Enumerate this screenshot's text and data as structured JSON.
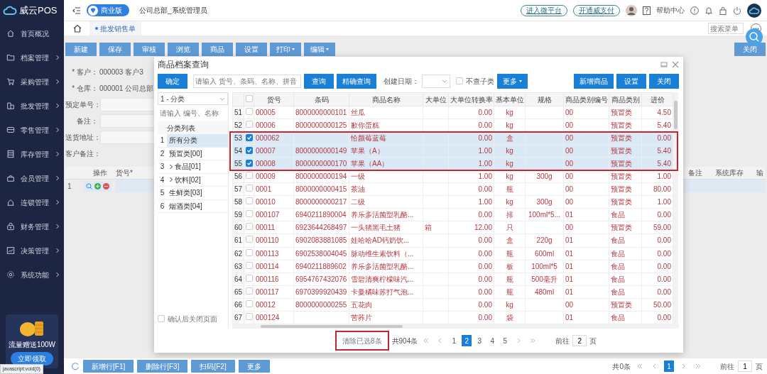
{
  "sidebar": {
    "logo": "威云POS",
    "items": [
      {
        "label": "首页概况",
        "expandable": false
      },
      {
        "label": "档案管理",
        "expandable": true
      },
      {
        "label": "采购管理",
        "expandable": true
      },
      {
        "label": "批发管理",
        "expandable": true
      },
      {
        "label": "零售管理",
        "expandable": true
      },
      {
        "label": "库存管理",
        "expandable": true
      },
      {
        "label": "会员管理",
        "expandable": true
      },
      {
        "label": "连锁管理",
        "expandable": true
      },
      {
        "label": "财务管理",
        "expandable": true
      },
      {
        "label": "决策管理",
        "expandable": true
      },
      {
        "label": "系统功能",
        "expandable": true
      }
    ],
    "promo": {
      "text": "流量赠送100W",
      "button": "立即领取"
    }
  },
  "status_text": "javascript:void(0)",
  "topbar": {
    "edition": "商业版",
    "user": "公司总部_系统管理员",
    "links": [
      "进入微平台",
      "开通威支付"
    ],
    "help": "帮助中心"
  },
  "tabs": [
    {
      "label": "批发销售单",
      "selected": true
    }
  ],
  "menu_search": {
    "placeholder": "搜索菜单"
  },
  "toolbar": [
    {
      "label": "新建",
      "dropdown": false
    },
    {
      "label": "保存",
      "dropdown": false
    },
    {
      "label": "审核",
      "dropdown": false
    },
    {
      "label": "浏览",
      "dropdown": false
    },
    {
      "label": "商品",
      "dropdown": false
    },
    {
      "label": "设置",
      "dropdown": false
    },
    {
      "label": "打印",
      "dropdown": true
    },
    {
      "label": "编辑",
      "dropdown": true
    }
  ],
  "close_button": "关闭",
  "form": [
    {
      "label": "* 客户：",
      "value": "000003  客户3",
      "field": false
    },
    {
      "label": "* 仓库：",
      "value": "000001 公司总部",
      "field": false
    },
    {
      "label": "预定单号：",
      "field": true
    },
    {
      "label": "备注：",
      "field": true
    },
    {
      "label": "送货地址：",
      "field": true
    },
    {
      "label": "客户备注：",
      "field": false
    }
  ],
  "grid": {
    "columns_left": [
      "操作",
      "货号*"
    ],
    "columns_right": [
      "备注",
      "系统库存",
      "输"
    ],
    "rows": [
      {
        "number": "1"
      }
    ]
  },
  "bottom_buttons": [
    "新增行[F1]",
    "删除行[F3]",
    "扫码[F2]",
    "更多"
  ],
  "bottom_pager": {
    "total": "共0条",
    "pages": [
      {
        "label": "1",
        "selected": true
      }
    ],
    "goto_label": "前往",
    "goto_value": "1",
    "page_unit": "页"
  },
  "dialog": {
    "title": "商品档案查询",
    "confirm": "确定",
    "search": {
      "placeholder": "请输入 货号、条码、名称、拼音"
    },
    "query_buttons": [
      "查询",
      "精确查询"
    ],
    "date_label": "创建日期：",
    "exclude_sub": {
      "label": "不查子类",
      "checked": false
    },
    "more": "更多",
    "right_buttons": [
      "新增商品",
      "设置",
      "关闭"
    ],
    "category_select": "1 - 分类",
    "category_search": {
      "placeholder": "请输入 编号、名称"
    },
    "category_header": "分类列表",
    "categories": [
      {
        "number": "1",
        "label": "所有分类",
        "selected": true,
        "expandable": false
      },
      {
        "number": "2",
        "label": "预置类[00]",
        "selected": false,
        "expandable": false
      },
      {
        "number": "3",
        "label": "食品[01]",
        "selected": false,
        "expandable": true
      },
      {
        "number": "4",
        "label": "饮料[02]",
        "selected": false,
        "expandable": true
      },
      {
        "number": "5",
        "label": "生鲜类[03]",
        "selected": false,
        "expandable": false
      },
      {
        "number": "6",
        "label": "烟酒类[04]",
        "selected": false,
        "expandable": false
      }
    ],
    "close_after_confirm": {
      "label": "确认后关闭页面",
      "checked": false
    },
    "table": {
      "select_all": false,
      "columns": [
        "货号",
        "条码",
        "商品名称",
        "大单位",
        "大单位转换率",
        "基本单位",
        "规格",
        "商品类别编号",
        "商品类别",
        "进价"
      ],
      "rows": [
        {
          "number": "51",
          "checked": false,
          "emphasized": false,
          "cells": [
            "00005",
            "8000000000101",
            "丝瓜",
            "",
            "0.00",
            "kg",
            "",
            "00",
            "预置类",
            "4.50"
          ]
        },
        {
          "number": "52",
          "checked": false,
          "emphasized": false,
          "cells": [
            "00006",
            "8000000000125",
            "歉你蛋糕",
            "",
            "0.00",
            "kg",
            "",
            "00",
            "预置类",
            "5.40"
          ]
        },
        {
          "number": "53",
          "checked": true,
          "emphasized": true,
          "cells": [
            "000062",
            "",
            "恰颜莓蓝莓",
            "",
            "0.00",
            "盒",
            "",
            "00",
            "预置类",
            "0.00"
          ]
        },
        {
          "number": "54",
          "checked": true,
          "emphasized": true,
          "cells": [
            "00007",
            "8000000000149",
            "苹果（A）",
            "",
            "1.00",
            "kg",
            "",
            "00",
            "预置类",
            "5.40"
          ]
        },
        {
          "number": "55",
          "checked": true,
          "emphasized": true,
          "cells": [
            "00008",
            "8000000000170",
            "苹果（AA）",
            "",
            "1.00",
            "kg",
            "",
            "00",
            "预置类",
            "5.40"
          ]
        },
        {
          "number": "56",
          "checked": false,
          "emphasized": false,
          "cells": [
            "00009",
            "8000000000194",
            "一级",
            "",
            "1.00",
            "kg",
            "300g",
            "00",
            "预置类",
            "1.00"
          ]
        },
        {
          "number": "57",
          "checked": false,
          "emphasized": false,
          "cells": [
            "0001",
            "8000000000415",
            "茶油",
            "",
            "0.00",
            "瓶",
            "",
            "00",
            "预置类",
            "80.00"
          ]
        },
        {
          "number": "58",
          "checked": false,
          "emphasized": false,
          "cells": [
            "00010",
            "8000000000217",
            "二级",
            "",
            "1.00",
            "kg",
            "300g",
            "00",
            "预置类",
            "1.00"
          ]
        },
        {
          "number": "59",
          "checked": false,
          "emphasized": false,
          "cells": [
            "000107",
            "6940211890004",
            "养乐多活菌型乳酪...",
            "",
            "0.00",
            "排",
            "100ml*5...",
            "01",
            "食品",
            "0.00"
          ]
        },
        {
          "number": "60",
          "checked": false,
          "emphasized": false,
          "cells": [
            "00011",
            "6923644268497",
            "一头猪黑毛土猪",
            "箱",
            "12.00",
            "只",
            "",
            "00",
            "预置类",
            "59.00"
          ]
        },
        {
          "number": "61",
          "checked": false,
          "emphasized": false,
          "cells": [
            "000110",
            "6902083881085",
            "娃哈哈AD钙奶饮...",
            "",
            "0.00",
            "盒",
            "220g",
            "01",
            "食品",
            "0.00"
          ]
        },
        {
          "number": "62",
          "checked": false,
          "emphasized": false,
          "cells": [
            "000113",
            "6902538004045",
            "脉动维生素饮料（...",
            "",
            "0.00",
            "瓶",
            "600ml",
            "01",
            "食品",
            "0.00"
          ]
        },
        {
          "number": "63",
          "checked": false,
          "emphasized": false,
          "cells": [
            "000114",
            "6940211889602",
            "养乐多活菌型乳酪...",
            "",
            "0.00",
            "板",
            "100ml*5",
            "01",
            "食品",
            "0.00"
          ]
        },
        {
          "number": "64",
          "checked": false,
          "emphasized": false,
          "cells": [
            "000116",
            "6954767432076",
            "雪碧清爽柠檬味汽...",
            "",
            "0.00",
            "瓶",
            "500毫升",
            "01",
            "食品",
            "0.00"
          ]
        },
        {
          "number": "65",
          "checked": false,
          "emphasized": false,
          "cells": [
            "000117",
            "6970399920439",
            "卡曼橘味苏打气泡...",
            "",
            "0.00",
            "瓶",
            "480ml",
            "01",
            "食品",
            "0.00"
          ]
        },
        {
          "number": "66",
          "checked": false,
          "emphasized": false,
          "cells": [
            "00012",
            "8000000000255",
            "五花肉",
            "",
            "0.00",
            "kg",
            "",
            "00",
            "预置类",
            "50.00"
          ]
        },
        {
          "number": "67",
          "checked": false,
          "emphasized": false,
          "cells": [
            "000124",
            "",
            "苦荞片",
            "",
            "0.00",
            "袋",
            "",
            "01",
            "食品",
            "0.00"
          ]
        }
      ]
    },
    "footer": {
      "clear_selected": {
        "label": "清除已选8条",
        "emphasized": true
      },
      "total": "共904条",
      "pages": [
        {
          "label": "1",
          "selected": false
        },
        {
          "label": "2",
          "selected": true
        },
        {
          "label": "3",
          "selected": false
        },
        {
          "label": "4",
          "selected": false
        },
        {
          "label": "5",
          "selected": false
        }
      ],
      "goto_label": "前往",
      "goto_value": "2",
      "page_unit": "页"
    }
  }
}
